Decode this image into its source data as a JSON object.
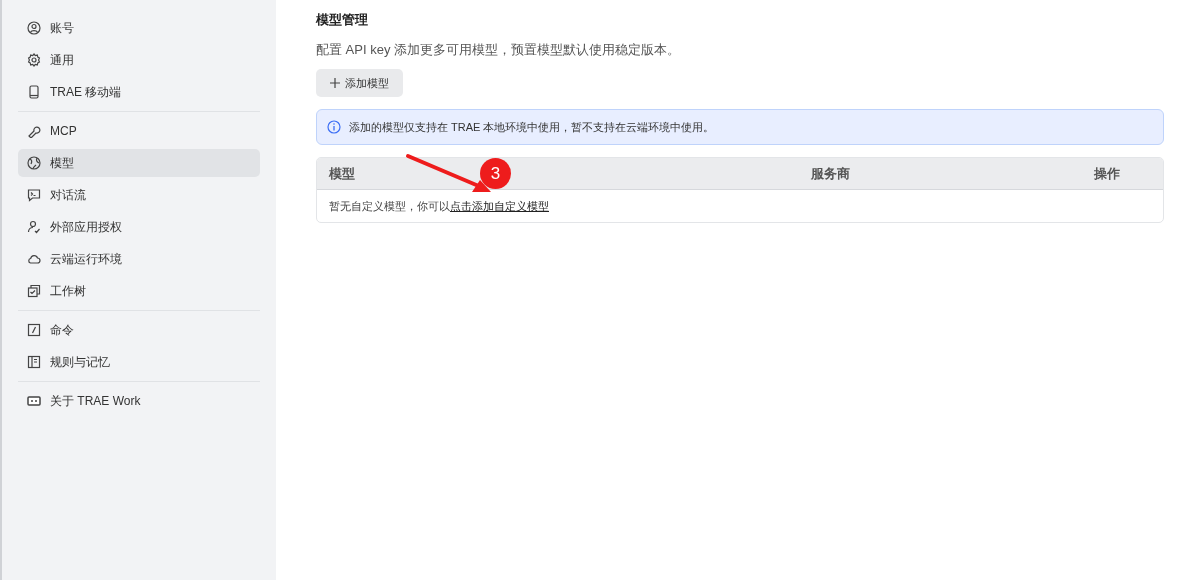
{
  "sidebar": {
    "groups": [
      {
        "items": [
          {
            "label": "账号",
            "selected": false
          },
          {
            "label": "通用",
            "selected": false
          },
          {
            "label": "TRAE 移动端",
            "selected": false
          }
        ]
      },
      {
        "items": [
          {
            "label": "MCP",
            "selected": false
          },
          {
            "label": "模型",
            "selected": true
          },
          {
            "label": "对话流",
            "selected": false
          },
          {
            "label": "外部应用授权",
            "selected": false
          },
          {
            "label": "云端运行环境",
            "selected": false
          },
          {
            "label": "工作树",
            "selected": false
          }
        ]
      },
      {
        "items": [
          {
            "label": "命令",
            "selected": false
          },
          {
            "label": "规则与记忆",
            "selected": false
          }
        ]
      },
      {
        "items": [
          {
            "label": "关于 TRAE Work",
            "selected": false
          }
        ]
      }
    ]
  },
  "main": {
    "title": "模型管理",
    "description": "配置 API key 添加更多可用模型，预置模型默认使用稳定版本。",
    "add_button": "添加模型",
    "notice": "添加的模型仅支持在 TRAE 本地环境中使用，暂不支持在云端环境中使用。",
    "table": {
      "columns": [
        "模型",
        "服务商",
        "操作"
      ],
      "empty_text": "暂无自定义模型，你可以",
      "empty_link": "点击添加自定义模型"
    }
  },
  "annotation": {
    "badge": "3"
  }
}
